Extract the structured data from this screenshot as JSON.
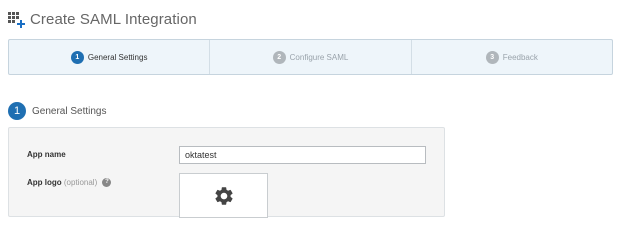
{
  "header": {
    "title": "Create SAML Integration",
    "icon": "add-app-grid-icon"
  },
  "wizard": {
    "steps": [
      {
        "number": "1",
        "label": "General Settings",
        "active": true
      },
      {
        "number": "2",
        "label": "Configure SAML",
        "active": false
      },
      {
        "number": "3",
        "label": "Feedback",
        "active": false
      }
    ]
  },
  "section": {
    "number": "1",
    "title": "General Settings"
  },
  "form": {
    "app_name_label": "App name",
    "app_name_value": "oktatest",
    "app_logo_label": "App logo",
    "app_logo_optional": "(optional)",
    "help_glyph": "?",
    "logo_icon": "gear-icon"
  },
  "colors": {
    "accent": "#1f6fb2",
    "wizard_bg": "#eef5fa",
    "panel_bg": "#f5f5f5"
  }
}
